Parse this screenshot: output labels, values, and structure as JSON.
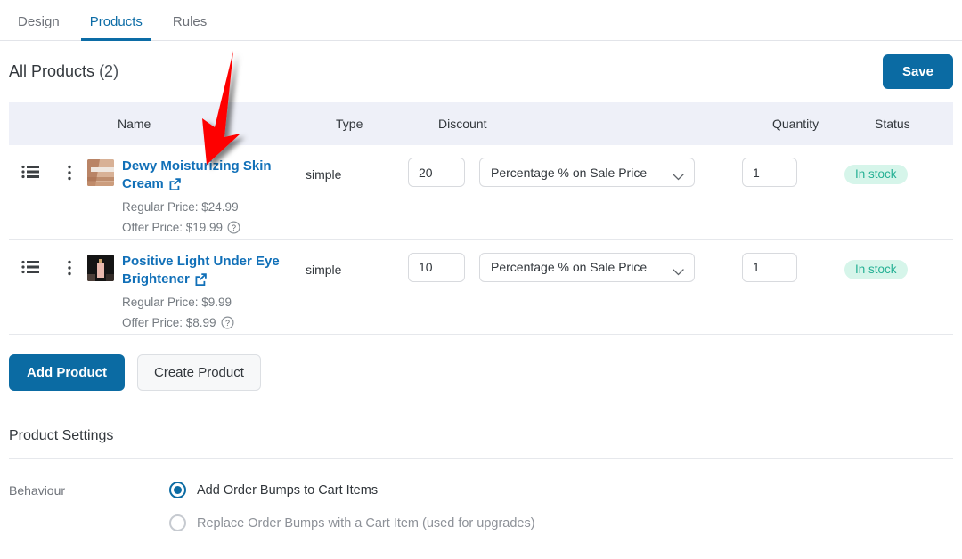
{
  "tabs": [
    {
      "label": "Design",
      "active": false
    },
    {
      "label": "Products",
      "active": true
    },
    {
      "label": "Rules",
      "active": false
    }
  ],
  "header": {
    "title": "All Products",
    "count": "(2)",
    "save_label": "Save"
  },
  "table": {
    "columns": {
      "name": "Name",
      "type": "Type",
      "discount": "Discount",
      "quantity": "Quantity",
      "status": "Status"
    },
    "rows": [
      {
        "name": "Dewy Moisturizing Skin Cream",
        "type": "simple",
        "regular_price": "Regular Price: $24.99",
        "offer_price": "Offer Price: $19.99",
        "discount_value": "20",
        "discount_type": "Percentage % on Sale Price",
        "quantity": "1",
        "status": "In stock"
      },
      {
        "name": "Positive Light Under Eye Brightener",
        "type": "simple",
        "regular_price": "Regular Price: $9.99",
        "offer_price": "Offer Price: $8.99",
        "discount_value": "10",
        "discount_type": "Percentage % on Sale Price",
        "quantity": "1",
        "status": "In stock"
      }
    ]
  },
  "actions": {
    "add_label": "Add Product",
    "create_label": "Create Product"
  },
  "settings": {
    "title": "Product Settings",
    "behaviour_label": "Behaviour",
    "options": [
      {
        "label": "Add Order Bumps to Cart Items",
        "selected": true
      },
      {
        "label": "Replace Order Bumps with a Cart Item (used for upgrades)",
        "selected": false
      }
    ]
  },
  "colors": {
    "accent": "#0b6ba3",
    "link": "#1170b8",
    "header_bg": "#eef0f8",
    "badge_bg": "#d6f5ea",
    "badge_text": "#25b094",
    "annotation": "#fe0000"
  }
}
